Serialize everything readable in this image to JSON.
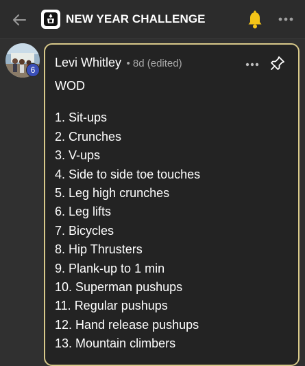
{
  "header": {
    "title": "NEW YEAR CHALLENGE",
    "icons": {
      "back": "back-arrow-icon",
      "logo": "group-logo-icon",
      "bell": "bell-icon",
      "more": "more-icon"
    },
    "bell_color": "#f5c518"
  },
  "post": {
    "author": "Levi Whitley",
    "meta": "• 8d (edited)",
    "level": "6",
    "title": "WOD",
    "items": [
      "1. Sit-ups",
      "2. Crunches",
      "3. V-ups",
      "4. Side to side toe touches",
      "5. Leg high crunches",
      "6. Leg lifts",
      "7. Bicycles",
      "8. Hip Thrusters",
      "9. Plank-up to 1 min",
      "10. Superman pushups",
      "11. Regular pushups",
      "12. Hand release pushups",
      "13. Mountain climbers"
    ],
    "icons": {
      "more": "more-icon",
      "pin": "pin-icon"
    },
    "accent": "#d8c98a",
    "badge_color": "#3a4fb8"
  }
}
